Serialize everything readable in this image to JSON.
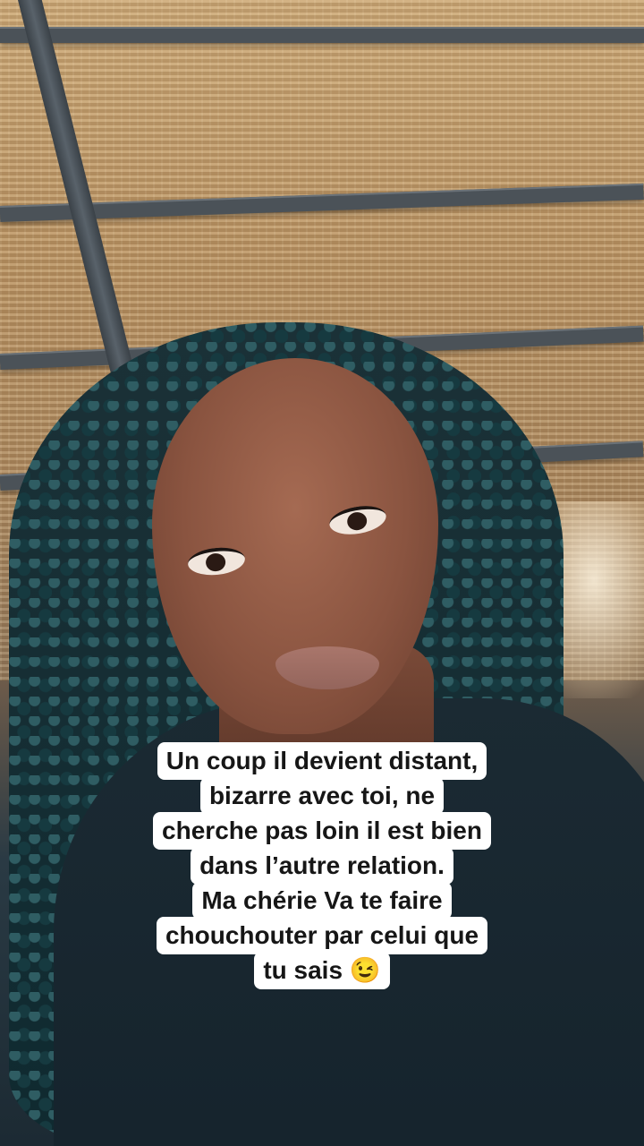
{
  "caption": {
    "lines": [
      "Un coup il devient distant,",
      "bizarre avec toi, ne",
      "cherche pas loin il est bien",
      "dans l’autre relation.",
      "Ma chérie Va te faire",
      "chouchouter par celui que",
      "tu sais 😉"
    ]
  },
  "colors": {
    "caption_background": "#ffffff",
    "caption_text": "#161616",
    "thatch": "#b58f60",
    "hair": "#163a40",
    "shirt": "#1b2a33"
  }
}
